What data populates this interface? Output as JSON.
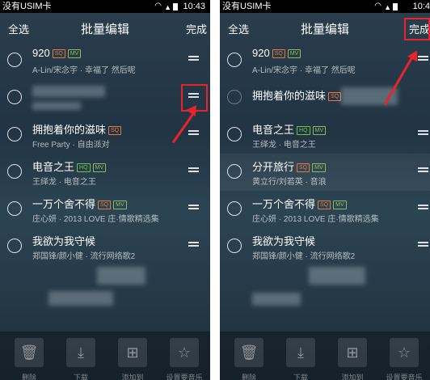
{
  "left": {
    "status": {
      "carrier": "没有USIM卡",
      "time": "10:43"
    },
    "header": {
      "select_all": "全选",
      "title": "批量编辑",
      "done": "完成"
    },
    "rows": [
      {
        "title": "920",
        "badges": [
          "SQ",
          "MV"
        ],
        "subtitle": "A-Lin/宋念宇 · 幸福了 然后呢"
      },
      {
        "title": "",
        "badges": [],
        "subtitle": ""
      },
      {
        "title": "拥抱着你的滋味",
        "badges": [
          "SQ"
        ],
        "subtitle": "Free Party · 自由派对"
      },
      {
        "title": "电音之王",
        "badges": [
          "HQ",
          "MV"
        ],
        "subtitle": "王绎龙 · 电音之王"
      },
      {
        "title": "一万个舍不得",
        "badges": [
          "SQ",
          "MV"
        ],
        "subtitle": "庄心妍 · 2013 LOVE 庄·情歌精选集"
      },
      {
        "title": "我欲为我守候",
        "badges": [],
        "subtitle": "郑国锋/颜小健 · 流行网络歌2"
      }
    ],
    "bottom": [
      "删除",
      "下载",
      "添加到",
      "设置要音乐"
    ]
  },
  "right": {
    "status": {
      "carrier": "没有USIM卡",
      "time": "10:4"
    },
    "header": {
      "select_all": "全选",
      "title": "批量编辑",
      "done": "完成"
    },
    "rows": [
      {
        "title": "920",
        "badges": [
          "SQ",
          "MV"
        ],
        "subtitle": "A-Lin/宋念宇 · 幸福了 然后呢"
      },
      {
        "title": "拥抱着你的滋味",
        "badges": [
          "SQ"
        ],
        "subtitle": ""
      },
      {
        "title": "电音之王",
        "badges": [
          "HQ",
          "MV"
        ],
        "subtitle": "王绎龙 · 电音之王"
      },
      {
        "title": "分开旅行",
        "badges": [
          "SQ",
          "MV"
        ],
        "subtitle": "黄立行/刘若英 · 音浪"
      },
      {
        "title": "一万个舍不得",
        "badges": [
          "SQ",
          "MV"
        ],
        "subtitle": "庄心妍 · 2013 LOVE 庄·情歌精选集"
      },
      {
        "title": "我欲为我守候",
        "badges": [],
        "subtitle": "郑国锋/颜小健 · 流行网络歌2"
      }
    ],
    "bottom": [
      "删除",
      "下载",
      "添加到",
      "设置要音乐"
    ]
  },
  "colors": {
    "annotation_red": "#e8242a",
    "sq_badge": "#e77a3c",
    "hq_badge": "#6fc24b"
  }
}
